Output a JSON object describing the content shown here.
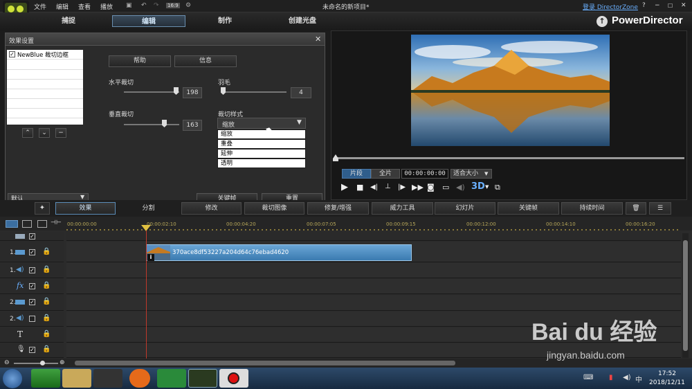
{
  "menu": {
    "file": "文件",
    "edit": "编辑",
    "view": "查看",
    "play": "播放",
    "project_title": "未命名的新项目*",
    "login": "登录 DirectorZone",
    "help": "?",
    "resolution_icon": "16:9"
  },
  "main_tabs": [
    {
      "label": "捕捉"
    },
    {
      "label": "编辑"
    },
    {
      "label": "制作"
    },
    {
      "label": "创建光盘"
    }
  ],
  "brand": "PowerDirector",
  "effect_panel": {
    "title": "效果设置",
    "effect_item": "NewBlue 裁切边框",
    "help_btn": "帮助",
    "info_btn": "信息",
    "h_crop_label": "水平裁切",
    "h_crop_value": "198",
    "feather_label": "羽毛",
    "feather_value": "4",
    "v_crop_label": "垂直裁切",
    "v_crop_value": "163",
    "crop_style_label": "裁切样式",
    "crop_style_selected": "缩放",
    "crop_style_options": [
      "缩放",
      "重叠",
      "延伸",
      "透明"
    ],
    "preset_value": "默认",
    "keyframe_btn": "关键帧",
    "reset_btn": "重置"
  },
  "preview": {
    "clip_tab": "片段",
    "full_tab": "全片",
    "timecode": "00:00:00:00",
    "fit": "适合大小",
    "mode_3d": "3D"
  },
  "fx_toolbar": [
    "效果",
    "分割",
    "修改",
    "裁切图像",
    "修复/增强",
    "威力工具",
    "幻灯片",
    "关键帧",
    "持续时间"
  ],
  "ruler": [
    "00:00:00:00",
    "00:00:02:10",
    "00:00:04:20",
    "00:00:07:05",
    "00:00:09:15",
    "00:00:12:00",
    "00:00:14:10",
    "00:00:16:20"
  ],
  "tracks": [
    {
      "num": "",
      "icon": "video-track-icon"
    },
    {
      "num": "1.",
      "icon": "video-track-icon"
    },
    {
      "num": "1.",
      "icon": "audio-track-icon"
    },
    {
      "num": "",
      "icon": "fx"
    },
    {
      "num": "2.",
      "icon": "video-track-icon"
    },
    {
      "num": "2.",
      "icon": "audio-track-icon"
    },
    {
      "num": "",
      "icon": "T"
    },
    {
      "num": "",
      "icon": "mic-icon"
    }
  ],
  "clip": {
    "name": "370ace8df53227a204d64c76ebad4620"
  },
  "clock": {
    "time": "17:52",
    "date": "2018/12/11"
  },
  "watermark": {
    "brand": "Bai du 经验",
    "url": "jingyan.baidu.com"
  },
  "colors": {
    "accent": "#5b8db8",
    "clip": "#4a88b8",
    "playhead": "#c0392b"
  }
}
